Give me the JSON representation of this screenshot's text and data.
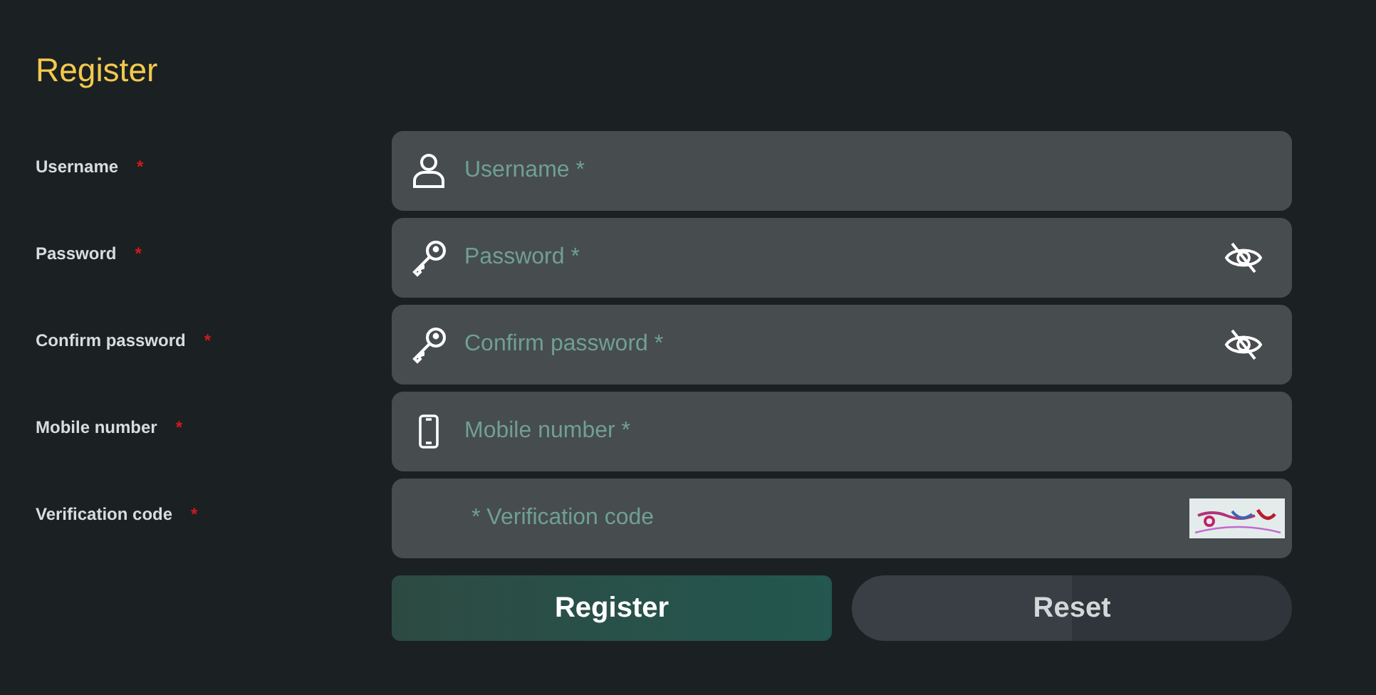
{
  "title": "Register",
  "fields": [
    {
      "kind": "text",
      "label": "Username",
      "required_mark": "*",
      "placeholder": "Username *"
    },
    {
      "kind": "password",
      "label": "Password",
      "required_mark": "*",
      "placeholder": "Password *",
      "password_visible": false
    },
    {
      "kind": "password",
      "label": "Confirm password",
      "required_mark": "*",
      "placeholder": "Confirm password *",
      "password_visible": false
    },
    {
      "kind": "phone",
      "label": "Mobile number",
      "required_mark": "*",
      "placeholder": "Mobile number *"
    },
    {
      "kind": "captcha",
      "label": "Verification code",
      "required_mark": "*",
      "placeholder": "* Verification code"
    }
  ],
  "buttons": [
    {
      "kind": "primary",
      "label": "Register"
    },
    {
      "kind": "secondary",
      "label": "Reset"
    }
  ]
}
